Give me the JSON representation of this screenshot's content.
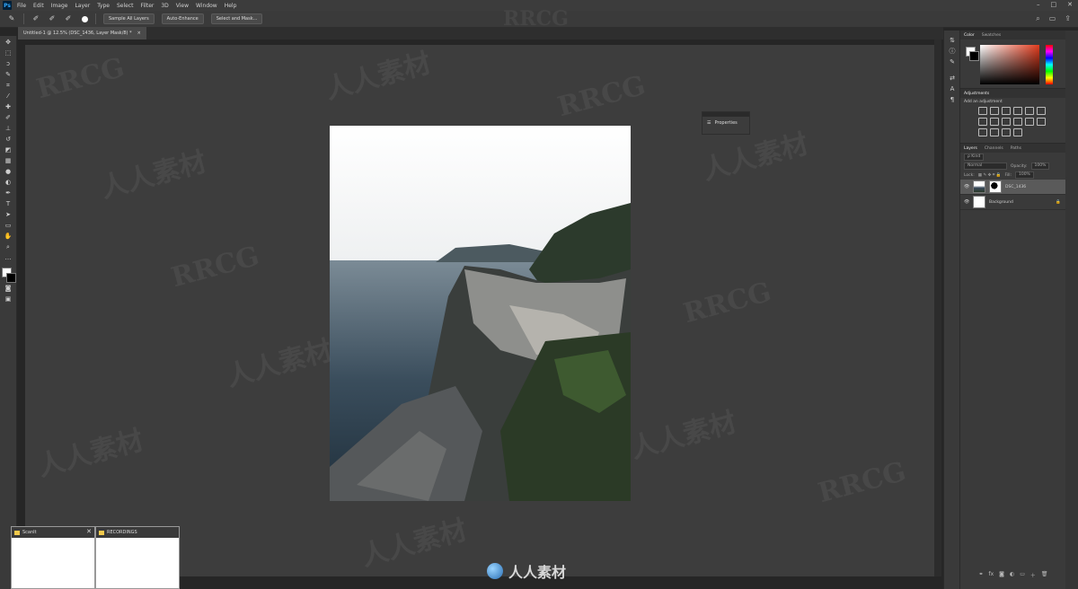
{
  "menubar": {
    "app_icon": "Ps",
    "items": [
      "File",
      "Edit",
      "Image",
      "Layer",
      "Type",
      "Select",
      "Filter",
      "3D",
      "View",
      "Window",
      "Help"
    ]
  },
  "options_bar": {
    "buttons": [
      "Sample All Layers",
      "Auto-Enhance",
      "Select and Mask..."
    ],
    "icons": [
      "quick-selection-icon",
      "brush-new-icon",
      "brush-add-icon",
      "brush-subtract-icon"
    ]
  },
  "document": {
    "tab_label": "Untitled-1 @ 12.5% (DSC_1436, Layer Mask/8) *",
    "close": "×"
  },
  "properties_mini": {
    "label": "Properties"
  },
  "panels": {
    "color_tabs": [
      "Color",
      "Swatches"
    ],
    "adjustments_title": "Adjustments",
    "adjustments_subtitle": "Add an adjustment",
    "layers_tabs": [
      "Layers",
      "Channels",
      "Paths"
    ],
    "kind_label": "ρ Kind",
    "blend_mode": "Normal",
    "opacity_label": "Opacity:",
    "opacity_value": "100%",
    "lock_label": "Lock:",
    "fill_label": "Fill:",
    "fill_value": "100%",
    "layers": [
      {
        "name": "DSC_1436",
        "selected": true
      },
      {
        "name": "Background",
        "selected": false
      }
    ]
  },
  "taskbar_thumbs": [
    {
      "title": "ScanIt"
    },
    {
      "title": "RECORDINGS"
    }
  ],
  "watermarks": {
    "rrcg": "RRCG",
    "cn": "人人素材",
    "footer_brand": "人人素材"
  },
  "colors": {
    "canvas_bg": "#3d3d3d",
    "panel_bg": "#3a3a3a",
    "accent_red": "#e23c1e"
  }
}
